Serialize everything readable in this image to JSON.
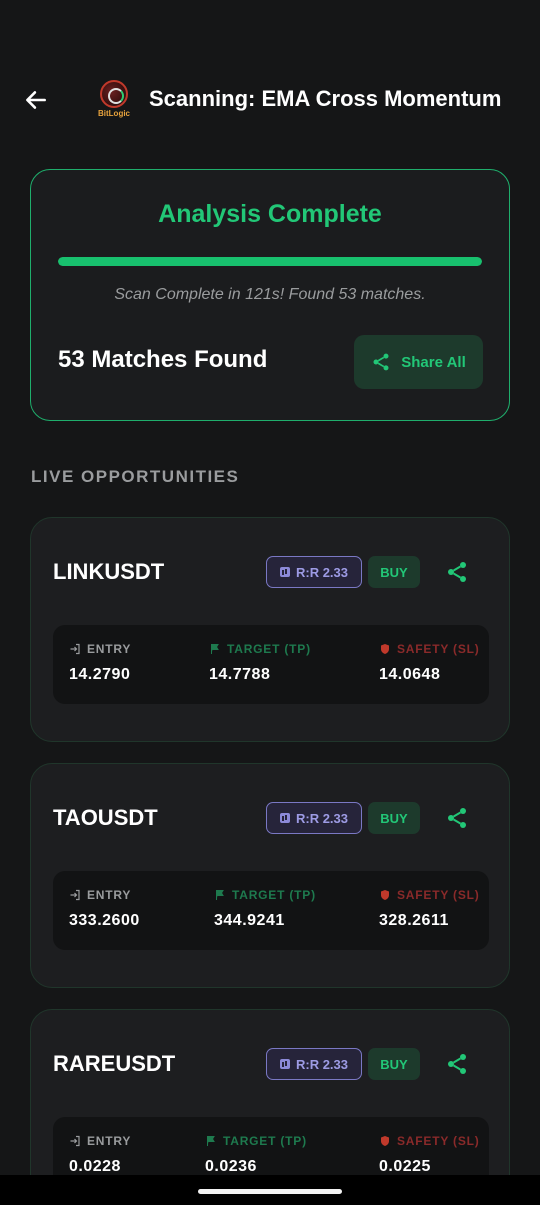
{
  "header": {
    "title": "Scanning: EMA Cross Momentum",
    "logo_text": "BitLogic"
  },
  "summary": {
    "heading": "Analysis Complete",
    "progress": 1.0,
    "status": "Scan Complete in 121s! Found 53 matches.",
    "matches": "53 Matches Found",
    "share_all_label": "Share All"
  },
  "section_label": "LIVE OPPORTUNITIES",
  "labels": {
    "entry": "ENTRY",
    "target": "TARGET (TP)",
    "safety": "SAFETY (SL)"
  },
  "opportunities": [
    {
      "symbol": "LINKUSDT",
      "rr": "R:R 2.33",
      "side": "BUY",
      "entry": "14.2790",
      "target": "14.7788",
      "safety": "14.0648"
    },
    {
      "symbol": "TAOUSDT",
      "rr": "R:R 2.33",
      "side": "BUY",
      "entry": "333.2600",
      "target": "344.9241",
      "safety": "328.2611"
    },
    {
      "symbol": "RAREUSDT",
      "rr": "R:R 2.33",
      "side": "BUY",
      "entry": "0.0228",
      "target": "0.0236",
      "safety": "0.0225"
    }
  ],
  "colors": {
    "accent_green": "#22c777",
    "rr_purple": "#9d9be4",
    "safety_red": "#8a2a2a",
    "background": "#151617"
  },
  "icons": {
    "back": "arrow-left-icon",
    "share": "share-icon",
    "entry": "login-icon",
    "target": "flag-icon",
    "safety": "shield-icon",
    "rr": "chart-icon"
  }
}
